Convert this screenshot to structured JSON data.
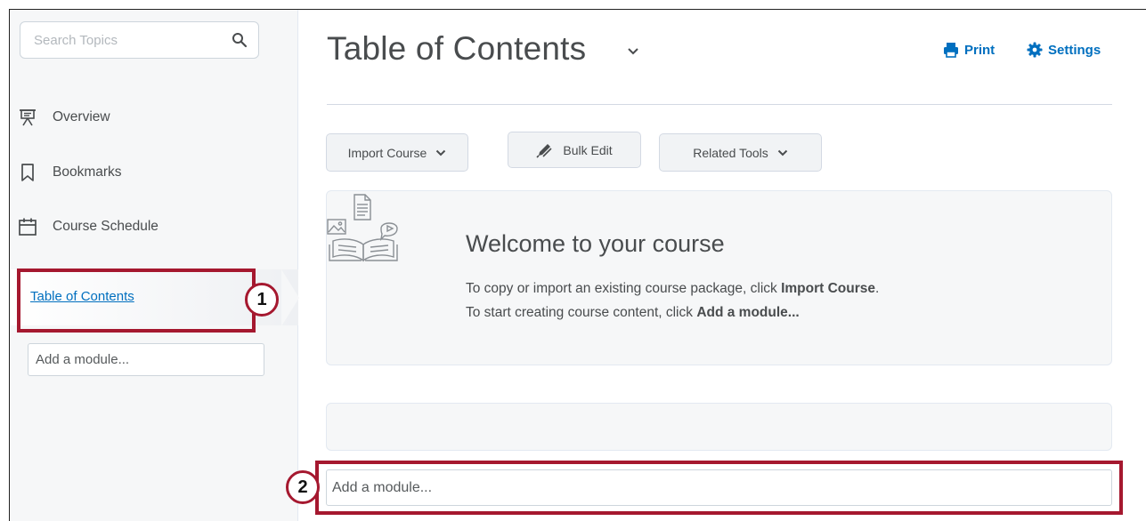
{
  "sidebar": {
    "search": {
      "placeholder": "Search Topics",
      "icon": "search-icon"
    },
    "items": [
      {
        "label": "Overview",
        "icon": "presentation-icon"
      },
      {
        "label": "Bookmarks",
        "icon": "bookmark-icon"
      },
      {
        "label": "Course Schedule",
        "icon": "calendar-icon"
      }
    ],
    "toc_link": "Table of Contents",
    "add_module_placeholder": "Add a module..."
  },
  "header": {
    "title": "Table of Contents",
    "print_label": "Print",
    "settings_label": "Settings"
  },
  "toolbar": {
    "import_course": "Import Course",
    "bulk_edit": "Bulk Edit",
    "related_tools": "Related Tools"
  },
  "welcome": {
    "title": "Welcome to your course",
    "line1_prefix": "To copy or import an existing course package, click ",
    "line1_bold": "Import Course",
    "line1_suffix": ".",
    "line2_prefix": "To start creating course content, click ",
    "line2_bold": "Add a module..."
  },
  "main": {
    "add_module_placeholder": "Add a module..."
  },
  "annotations": {
    "callout_1": "1",
    "callout_2": "2"
  },
  "colors": {
    "link": "#006fbf",
    "highlight": "#a5182f",
    "text": "#494c4e"
  }
}
